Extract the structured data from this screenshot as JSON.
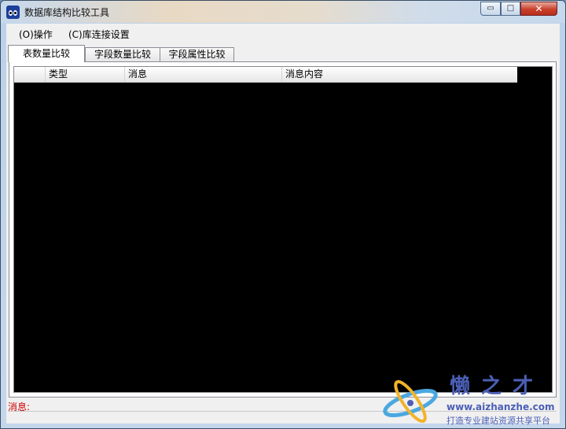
{
  "window": {
    "title": "数据库结构比较工具",
    "controls": {
      "minimize": "▭",
      "maximize": "□",
      "close": "✕"
    }
  },
  "menubar": {
    "items": [
      {
        "label": "(O)操作"
      },
      {
        "label": "(C)库连接设置"
      }
    ]
  },
  "tabs": [
    {
      "label": "表数量比较",
      "active": true
    },
    {
      "label": "字段数量比较",
      "active": false
    },
    {
      "label": "字段属性比较",
      "active": false
    }
  ],
  "grid": {
    "columns": [
      "",
      "类型",
      "消息",
      "消息内容"
    ],
    "rows": []
  },
  "status": {
    "label": "消息:",
    "value": ""
  },
  "watermark": {
    "name": "懒之才",
    "url": "www.aizhanzhe.com",
    "slogan": "打造专业建站资源共享平台"
  },
  "colors": {
    "status_label": "#d00000",
    "grid_background": "#000000",
    "watermark": "#4b5fb7"
  }
}
